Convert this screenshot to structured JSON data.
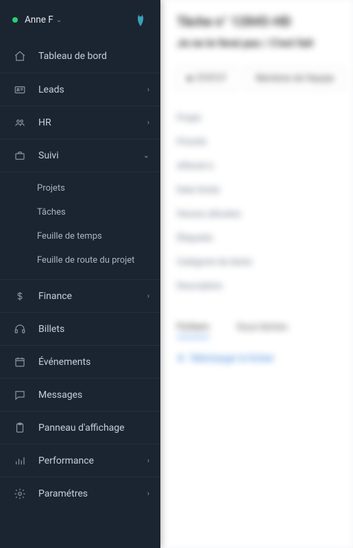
{
  "user": {
    "name": "Anne F",
    "status": "online"
  },
  "nav": {
    "dashboard": "Tableau de bord",
    "leads": "Leads",
    "hr": "HR",
    "tracking": "Suivi",
    "tracking_children": {
      "projects": "Projets",
      "tasks": "Tâches",
      "timesheet": "Feuille de temps",
      "roadmap": "Feuille de route du projet"
    },
    "finance": "Finance",
    "tickets": "Billets",
    "events": "Événements",
    "messages": "Messages",
    "notice": "Panneau d'affichage",
    "performance": "Performance",
    "settings": "Paramétres"
  },
  "main": {
    "title": "Tâche n° 12845-HD",
    "subtitle": "Je ne le ferai pas / C'est fait",
    "btn_status": "STATUT",
    "btn_users": "Membres de l'équipe",
    "fields": [
      "Projet",
      "Priorité",
      "Affecté à",
      "Date limite",
      "Heures allouées",
      "Étiquette",
      "Catégorie de tâche",
      "Description"
    ],
    "tabs": {
      "files": "Fichiers",
      "subtasks": "Sous-tâches"
    },
    "link": "Télécharger le fichier"
  }
}
